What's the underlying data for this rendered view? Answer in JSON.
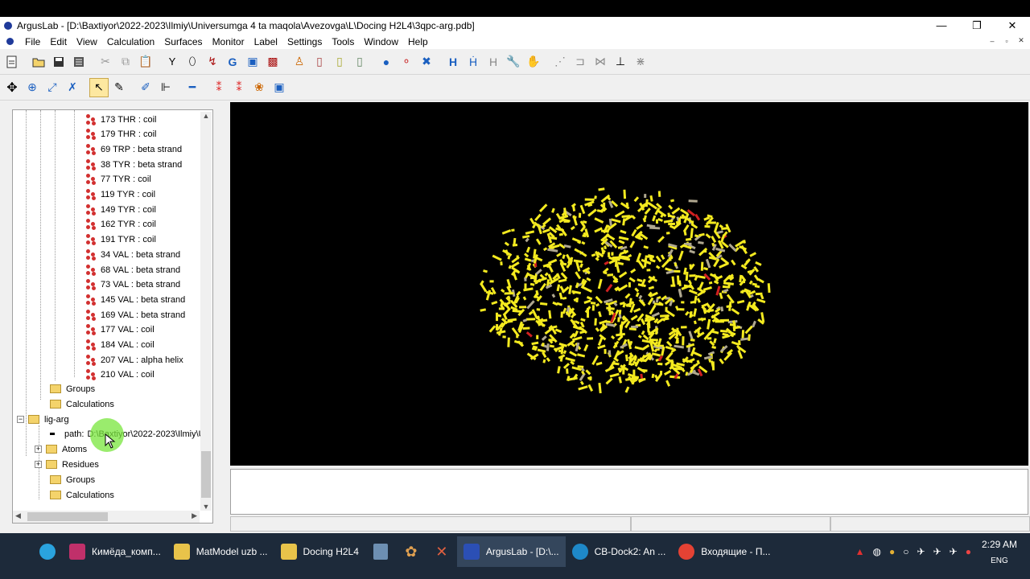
{
  "window": {
    "title": "ArgusLab - [D:\\Baxtiyor\\2022-2023\\Ilmiy\\Universumga 4 ta maqola\\Avezovga\\L\\Docing H2L4\\3qpc-arg.pdb]",
    "minimize": "—",
    "restore": "❐",
    "close": "✕"
  },
  "menu": [
    "File",
    "Edit",
    "View",
    "Calculation",
    "Surfaces",
    "Monitor",
    "Label",
    "Settings",
    "Tools",
    "Window",
    "Help"
  ],
  "mdi_controls": [
    "–",
    "▫",
    "✕"
  ],
  "toolbar1": [
    "new-icon",
    "open-icon",
    "save-icon",
    "print-icon",
    "sep",
    "cut-icon",
    "copy-icon",
    "paste-icon",
    "sep",
    "molecule-icon-1",
    "molecule-icon-2",
    "molecule-icon-3",
    "molecule-icon-4",
    "molecule-icon-5",
    "molecule-icon-6",
    "sep",
    "atom-icon-1",
    "atom-icon-2",
    "atom-icon-3",
    "atom-icon-4",
    "sep",
    "ball-icon",
    "ball-stick-icon",
    "delete-icon",
    "sep",
    "hydrogen-icon",
    "hydrogen-add-icon",
    "hydrogen-hide-icon",
    "wrench-icon",
    "hand-icon",
    "sep",
    "bond-icon-1",
    "bond-icon-2",
    "bond-icon-3",
    "bond-icon-4",
    "bond-icon-5"
  ],
  "toolbar2": [
    "translate-icon",
    "rotate-icon",
    "scale-icon",
    "clip-icon",
    "sep",
    "select-icon",
    "draw-icon",
    "sep",
    "paint-icon",
    "tree-icon",
    "sep",
    "link-icon",
    "sep",
    "atom-red-icon",
    "atom-red2-icon",
    "atom-multi-icon",
    "box-icon"
  ],
  "tree": {
    "residues": [
      "173 THR : coil",
      "179 THR : coil",
      "69 TRP : beta strand",
      "38 TYR : beta strand",
      "77 TYR : coil",
      "119 TYR : coil",
      "149 TYR : coil",
      "162 TYR : coil",
      "191 TYR : coil",
      "34 VAL : beta strand",
      "68 VAL : beta strand",
      "73 VAL : beta strand",
      "145 VAL : beta strand",
      "169 VAL : beta strand",
      "177 VAL : coil",
      "184 VAL : coil",
      "207 VAL : alpha helix",
      "210 VAL : coil"
    ],
    "groups_label": "Groups",
    "calculations_label": "Calculations",
    "lig_label": "lig-arg",
    "path_label": "path:",
    "path_value": "D:\\Baxtiyor\\2022-2023\\Ilmiy\\U",
    "atoms_label": "Atoms",
    "residues_label": "Residues",
    "groups2_label": "Groups",
    "calculations2_label": "Calculations"
  },
  "taskbar": {
    "apps": [
      {
        "label": "Кимёда_комп...",
        "color": "#c0306a"
      },
      {
        "label": "MatModel uzb ...",
        "color": "#e8c34a"
      },
      {
        "label": "Docing H2L4",
        "color": "#e8c34a"
      },
      {
        "label": "ArgusLab - [D:\\...",
        "color": "#2b4fb5"
      },
      {
        "label": "CB-Dock2: An ...",
        "color": "#1e88c8"
      },
      {
        "label": "Входящие - П...",
        "color": "#e44234"
      }
    ],
    "clock": "2:29 AM",
    "lang": "ENG"
  },
  "colors": {
    "molecule": "#f4ea1f",
    "viewport_bg": "#000000",
    "taskbar_bg": "#1d2a3a"
  }
}
